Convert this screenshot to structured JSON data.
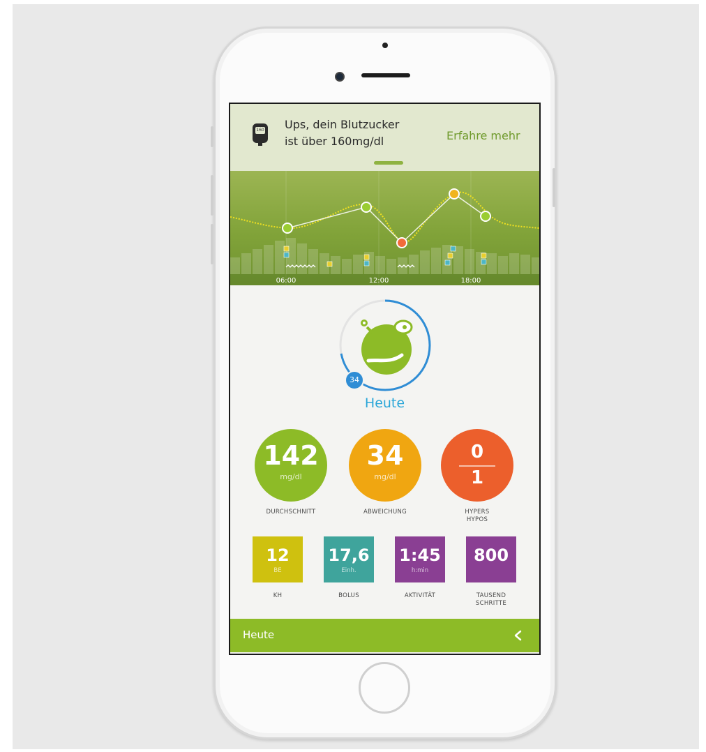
{
  "alert": {
    "meter_reading": "160",
    "message_line1": "Ups, dein Blutzucker",
    "message_line2": "ist über 160mg/dl",
    "action_label": "Erfahre mehr"
  },
  "chart_data": {
    "type": "line",
    "x_ticks": [
      "06:00",
      "12:00",
      "18:00"
    ],
    "readings": [
      {
        "time": "07:30",
        "status": "normal"
      },
      {
        "time": "11:00",
        "status": "normal"
      },
      {
        "time": "13:00",
        "status": "low"
      },
      {
        "time": "16:30",
        "status": "high"
      },
      {
        "time": "18:30",
        "status": "normal"
      }
    ],
    "colors": {
      "normal": "#9acd32",
      "low": "#f26b3a",
      "high": "#f0b41c",
      "trend": "#f0e020",
      "bolus_marker": "#4db6c5",
      "carb_marker": "#e8cf2e"
    }
  },
  "ring": {
    "badge_value": "34",
    "progress": 0.72,
    "label": "Heute",
    "color": "#2f8dd5"
  },
  "stats": {
    "average": {
      "value": "142",
      "unit": "mg/dl",
      "label": "DURCHSCHNITT",
      "color": "#8dbb27"
    },
    "deviation": {
      "value": "34",
      "unit": "mg/dl",
      "label": "ABWEICHUNG",
      "color": "#f0a611"
    },
    "hypers_hypos": {
      "hypers": "0",
      "hypos": "1",
      "label_line1": "HYPERS",
      "label_line2": "HYPOS",
      "color": "#ec5f2c"
    }
  },
  "tiles": {
    "carbs": {
      "value": "12",
      "unit": "BE",
      "label": "KH",
      "color": "#cfc10f"
    },
    "bolus": {
      "value": "17,6",
      "unit": "Einh.",
      "label": "BOLUS",
      "color": "#3fa49c"
    },
    "activity": {
      "value": "1:45",
      "unit": "h:min",
      "label": "AKTIVITÄT",
      "color": "#8a3f93"
    },
    "steps": {
      "value": "800",
      "unit": "",
      "label_line1": "TAUSEND",
      "label_line2": "SCHRITTE",
      "color": "#8a3f93"
    }
  },
  "footer": {
    "title": "Heute",
    "back_icon": "chevron-left-icon"
  }
}
